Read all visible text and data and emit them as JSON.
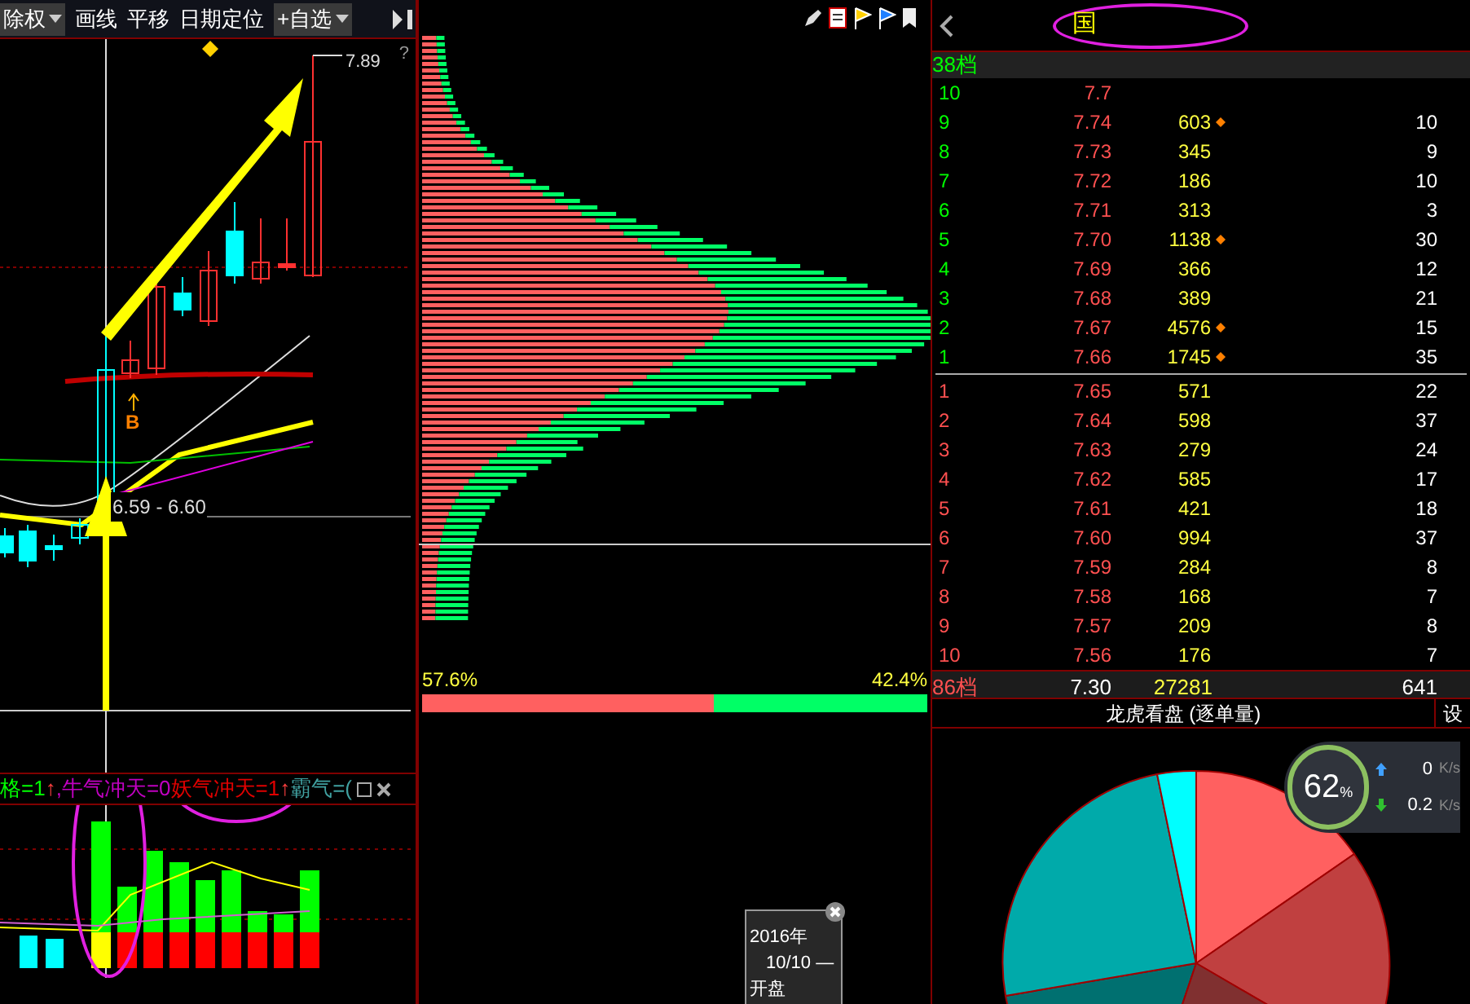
{
  "chart_toolbar": {
    "items": [
      {
        "label": "除权",
        "kind": "dropdown"
      },
      {
        "label": "画线",
        "kind": "plain"
      },
      {
        "label": "平移",
        "kind": "plain"
      },
      {
        "label": "日期定位",
        "kind": "plain"
      },
      {
        "label": "+自选",
        "kind": "dropdown"
      }
    ],
    "help": "?"
  },
  "price_chart": {
    "high_label": "7.89",
    "signal": "B",
    "range_label": "6.59 - 6.60"
  },
  "indicator": {
    "parts": [
      {
        "text": "格=1",
        "kind": "condition"
      },
      {
        "text": "↑",
        "kind": "arrow"
      },
      {
        "text": ",牛气冲天=0",
        "kind": "bull"
      },
      {
        "text": "妖气冲天=1",
        "kind": "demon"
      },
      {
        "text": "↑",
        "kind": "arrow"
      },
      {
        "text": "霸气=(",
        "kind": "dominance"
      }
    ]
  },
  "volume_profile": {
    "left_pct": "57.6%",
    "right_pct": "42.4%",
    "level": 0.576
  },
  "tooltip": {
    "lines": [
      "2016年",
      "10/10 —",
      "开盘"
    ]
  },
  "order_book": {
    "title": "国",
    "sell_header": "38档",
    "sell": [
      {
        "level": "10",
        "price": "7.7",
        "flag": false
      },
      {
        "level": "9",
        "price": "7.74",
        "volume": "603",
        "count": "10",
        "flag": true
      },
      {
        "level": "8",
        "price": "7.73",
        "volume": "345",
        "count": "9",
        "flag": false
      },
      {
        "level": "7",
        "price": "7.72",
        "volume": "186",
        "count": "10",
        "flag": false
      },
      {
        "level": "6",
        "price": "7.71",
        "volume": "313",
        "count": "3",
        "flag": false
      },
      {
        "level": "5",
        "price": "7.70",
        "volume": "1138",
        "count": "30",
        "flag": true
      },
      {
        "level": "4",
        "price": "7.69",
        "volume": "366",
        "count": "12",
        "flag": false
      },
      {
        "level": "3",
        "price": "7.68",
        "volume": "389",
        "count": "21",
        "flag": false
      },
      {
        "level": "2",
        "price": "7.67",
        "volume": "4576",
        "count": "15",
        "flag": true
      },
      {
        "level": "1",
        "price": "7.66",
        "volume": "1745",
        "count": "35",
        "flag": true
      }
    ],
    "buy": [
      {
        "level": "1",
        "price": "7.65",
        "volume": "571",
        "count": "22",
        "flag": false
      },
      {
        "level": "2",
        "price": "7.64",
        "volume": "598",
        "count": "37",
        "flag": false
      },
      {
        "level": "3",
        "price": "7.63",
        "volume": "279",
        "count": "24",
        "flag": false
      },
      {
        "level": "4",
        "price": "7.62",
        "volume": "585",
        "count": "17",
        "flag": false
      },
      {
        "level": "5",
        "price": "7.61",
        "volume": "421",
        "count": "18",
        "flag": false
      },
      {
        "level": "6",
        "price": "7.60",
        "volume": "994",
        "count": "37",
        "flag": false
      },
      {
        "level": "7",
        "price": "7.59",
        "volume": "284",
        "count": "8",
        "flag": false
      },
      {
        "level": "8",
        "price": "7.58",
        "volume": "168",
        "count": "7",
        "flag": false
      },
      {
        "level": "9",
        "price": "7.57",
        "volume": "209",
        "count": "8",
        "flag": false
      },
      {
        "level": "10",
        "price": "7.56",
        "volume": "176",
        "count": "7",
        "flag": false
      }
    ],
    "footer": {
      "label": "86档",
      "price": "7.30",
      "volume": "27281",
      "count": "641"
    }
  },
  "dragon_panel": {
    "title": "龙虎看盘 (逐单量)",
    "settings": "设"
  },
  "monitor": {
    "percent": "62",
    "percent_sign": "%",
    "up": "0",
    "up_unit": "K/s",
    "down": "0.2",
    "down_unit": "K/s"
  }
}
